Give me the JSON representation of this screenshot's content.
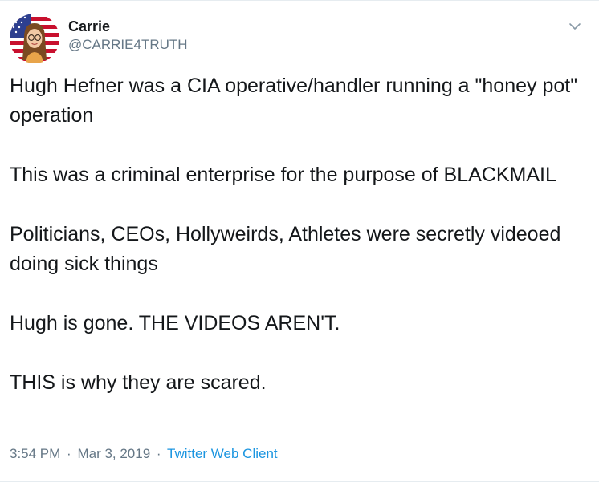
{
  "author": {
    "display_name": "Carrie",
    "handle": "@CARRIE4TRUTH"
  },
  "tweet": {
    "paragraphs": [
      "Hugh Hefner was a CIA operative/handler running a \"honey pot\" operation",
      "This was a criminal enterprise for the purpose of BLACKMAIL",
      "Politicians, CEOs, Hollyweirds, Athletes were secretly videoed doing sick things",
      "Hugh is gone. THE VIDEOS AREN'T.",
      "THIS is why they are scared."
    ]
  },
  "meta": {
    "time": "3:54 PM",
    "separator": "·",
    "date": "Mar 3, 2019",
    "client": "Twitter Web Client"
  },
  "colors": {
    "text": "#14171a",
    "secondary": "#657786",
    "link": "#1b95e0",
    "border": "#e6ecf0"
  },
  "icons": {
    "avatar": "avatar-us-flag-bitmoji",
    "menu": "chevron-down-icon"
  }
}
